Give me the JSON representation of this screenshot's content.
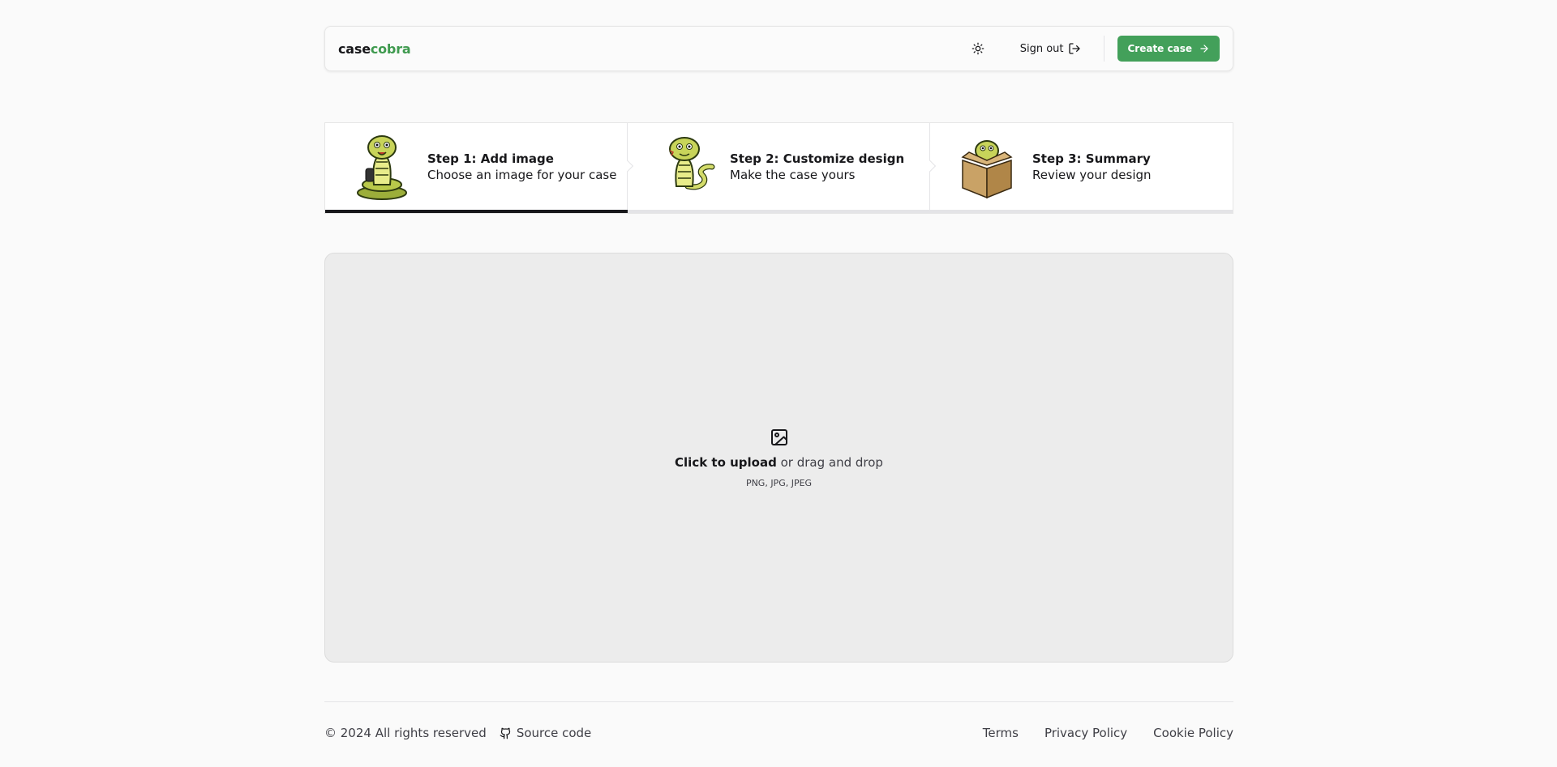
{
  "header": {
    "logo_part1": "case",
    "logo_part2": "cobra",
    "theme_icon": "sun-icon",
    "signout_label": "Sign out",
    "create_label": "Create case"
  },
  "steps": [
    {
      "title": "Step 1: Add image",
      "description": "Choose an image for your case",
      "active": true
    },
    {
      "title": "Step 2: Customize design",
      "description": "Make the case yours",
      "active": false
    },
    {
      "title": "Step 3: Summary",
      "description": "Review your design",
      "active": false
    }
  ],
  "upload": {
    "icon": "image-icon",
    "action": "Click to upload",
    "rest": "or drag and drop",
    "formats": "PNG, JPG, JPEG"
  },
  "footer": {
    "copyright": "© 2024 All rights reserved",
    "source_label": "Source code",
    "links": [
      "Terms",
      "Privacy Policy",
      "Cookie Policy"
    ]
  },
  "colors": {
    "brand": "#43a05a",
    "active_step": "#18181b"
  }
}
